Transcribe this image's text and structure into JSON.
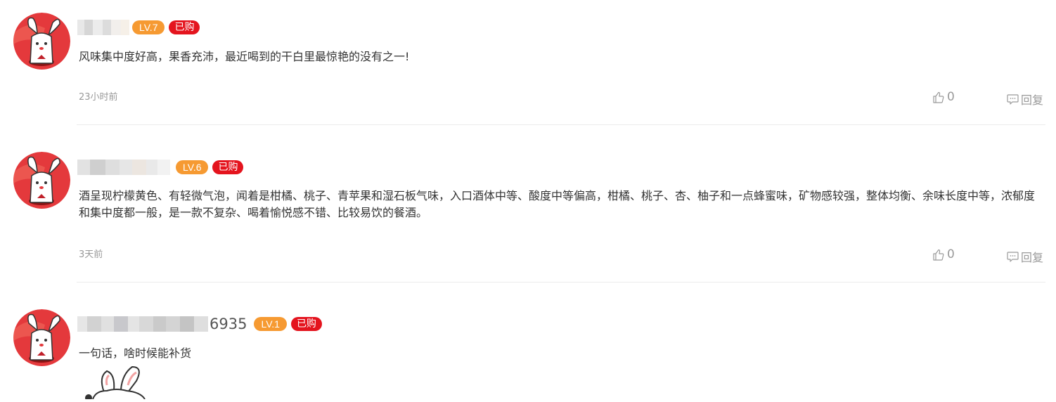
{
  "comments": [
    {
      "name_suffix": "",
      "level": "LV.7",
      "purchased": "已购",
      "text": "风味集中度好高，果香充沛，最近喝到的干白里最惊艳的没有之一!",
      "time": "23小时前",
      "likes": "0",
      "reply": "回复"
    },
    {
      "name_suffix": "",
      "level": "LV.6",
      "purchased": "已购",
      "text": "酒呈现柠檬黄色、有轻微气泡，闻着是柑橘、桃子、青苹果和湿石板气味，入口酒体中等、酸度中等偏高，柑橘、桃子、杏、柚子和一点蜂蜜味，矿物感较强，整体均衡、余味长度中等，浓郁度和集中度都一般，是一款不复杂、喝着愉悦感不错、比较易饮的餐酒。",
      "time": "3天前",
      "likes": "0",
      "reply": "回复"
    },
    {
      "name_suffix": "6935",
      "level": "LV.1",
      "purchased": "已购",
      "text": "一句话，啥时候能补货"
    }
  ],
  "colors": {
    "level_badge": "#f69a32",
    "purchased_badge": "#e4141e",
    "avatar_bg": "#e4393c",
    "muted_text": "#999999"
  },
  "icons": {
    "like": "thumbs-up-icon",
    "reply": "comment-bubble-icon",
    "avatar": "rabbit-avatar-icon",
    "sticker": "rabbit-sticker-icon"
  }
}
